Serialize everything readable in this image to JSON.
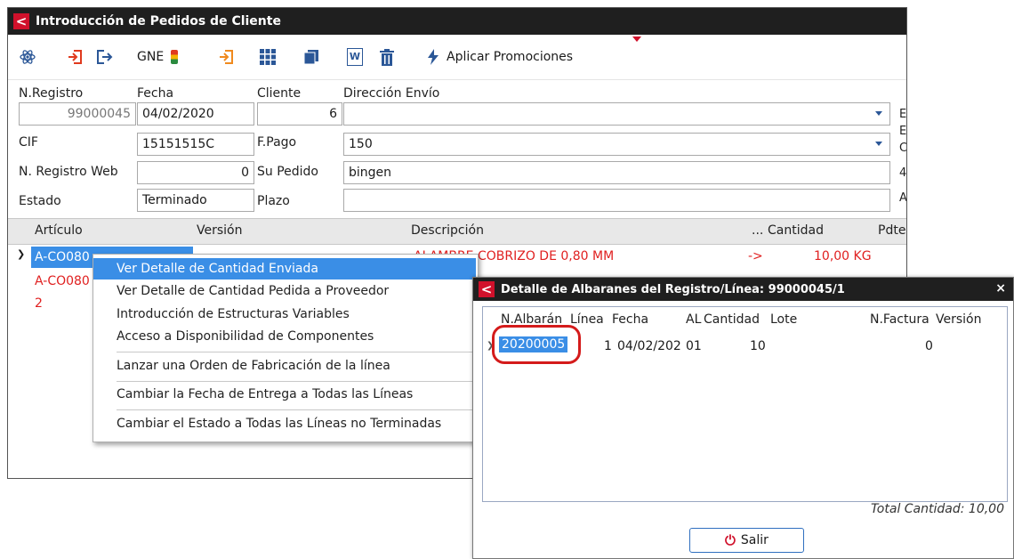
{
  "main_window": {
    "title": "Introducción de Pedidos de Cliente",
    "toolbar": {
      "gne_label": "GNE",
      "promo_label": "Aplicar Promociones"
    },
    "form": {
      "n_registro_label": "N.Registro",
      "n_registro_value": "99000045",
      "fecha_label": "Fecha",
      "fecha_value": "04/02/2020",
      "cliente_label": "Cliente",
      "cliente_value": "6",
      "direccion_label": "Dirección Envío",
      "direccion_value": "",
      "cif_label": "CIF",
      "cif_value": "15151515C",
      "fpago_label": "F.Pago",
      "fpago_value": "150",
      "nreg_web_label": "N. Registro Web",
      "nreg_web_value": "0",
      "supedido_label": "Su Pedido",
      "supedido_value": "bingen",
      "estado_label": "Estado",
      "estado_value": "Terminado",
      "plazo_label": "Plazo",
      "plazo_value": "",
      "right_cut": [
        "E",
        "E",
        "C",
        "4",
        "A"
      ]
    },
    "grid": {
      "headers": {
        "articulo": "Artículo",
        "version": "Versión",
        "descripcion": "Descripción",
        "dots": "...",
        "cantidad": "Cantidad",
        "pdte": "Pdte"
      },
      "rows": [
        {
          "articulo": "A-CO080",
          "descripcion": "ALAMBRE COBRIZO DE 0,80 MM",
          "arrow": "->",
          "cantidad": "10,00 KG"
        },
        {
          "articulo": "A-CO080"
        },
        {
          "articulo": "2"
        }
      ]
    }
  },
  "context_menu": {
    "items": [
      "Ver Detalle de Cantidad Enviada",
      "Ver Detalle de Cantidad Pedida a Proveedor",
      "Introducción de Estructuras Variables",
      "Acceso a Disponibilidad de Componentes",
      "Lanzar una Orden de Fabricación de la línea",
      "Cambiar la Fecha de Entrega a Todas las Líneas",
      "Cambiar el Estado a Todas las Líneas no Terminadas"
    ]
  },
  "dialog": {
    "title": "Detalle de Albaranes del Registro/Línea: 99000045/1",
    "close": "×",
    "headers": {
      "nalbaran": "N.Albarán",
      "linea": "Línea",
      "fecha": "Fecha",
      "al": "AL",
      "cantidad": "Cantidad",
      "lote": "Lote",
      "nfactura": "N.Factura",
      "version": "Versión"
    },
    "row": {
      "nalbaran": "20200005",
      "linea": "1",
      "fecha": "04/02/202",
      "al": "01",
      "cantidad": "10",
      "nfactura": "0"
    },
    "total_label": "Total Cantidad: 10,00",
    "salir_label": "Salir"
  }
}
